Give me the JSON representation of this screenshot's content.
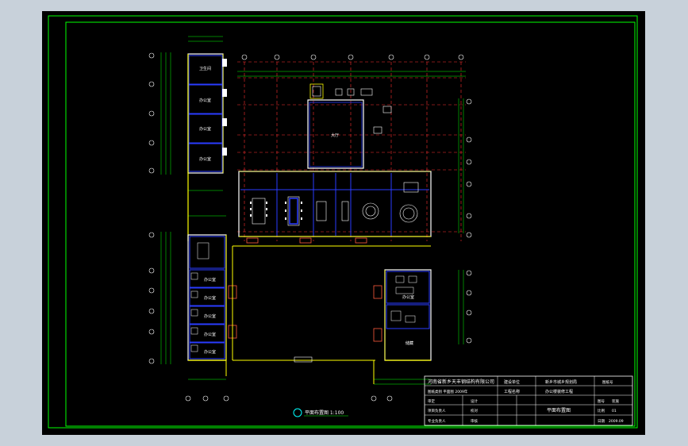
{
  "colors": {
    "background": "#c8d1da",
    "sheet": "#000000",
    "border": "#00ff00",
    "wall": "#ffffff",
    "partition": "#2a3cff",
    "dimension": "#00ff00",
    "axis": "#ff3030",
    "column": "#ffff00",
    "door": "#ff5a3c"
  },
  "drawing_title": {
    "icon": "circle-marker-icon",
    "caption": "平面布置图 1:100"
  },
  "title_block": {
    "company": "河南省新乡天丰钢结构有限公司",
    "project_label": "建设单位",
    "project_value": "新乡市城乡规划局",
    "drawing_name": "办公楼平面布置",
    "row2_left": "图纸类别 平面图 2009年",
    "row2_mid": "工程名称",
    "row2_right": "办公楼装修工程",
    "row3": [
      "审定",
      "设计",
      "图号"
    ],
    "row4": [
      "项目负责人",
      "校对",
      "比例"
    ],
    "row5": [
      "专业负责人",
      "审核",
      "日期"
    ],
    "drawing_label": "平面布置图",
    "sheet_no_label": "图纸号",
    "sheet_no_value": "装施",
    "version": "01",
    "date": "2009.09"
  },
  "room_labels": {
    "top_left_1": "卫生间",
    "top_left_2": "办公室",
    "top_left_3": "办公室",
    "top_left_4": "办公室",
    "center_hall": "大厅",
    "right_1": "办公室",
    "right_2": "储藏",
    "left_offices": [
      "办公室",
      "办公室",
      "办公室",
      "办公室",
      "办公室"
    ]
  }
}
